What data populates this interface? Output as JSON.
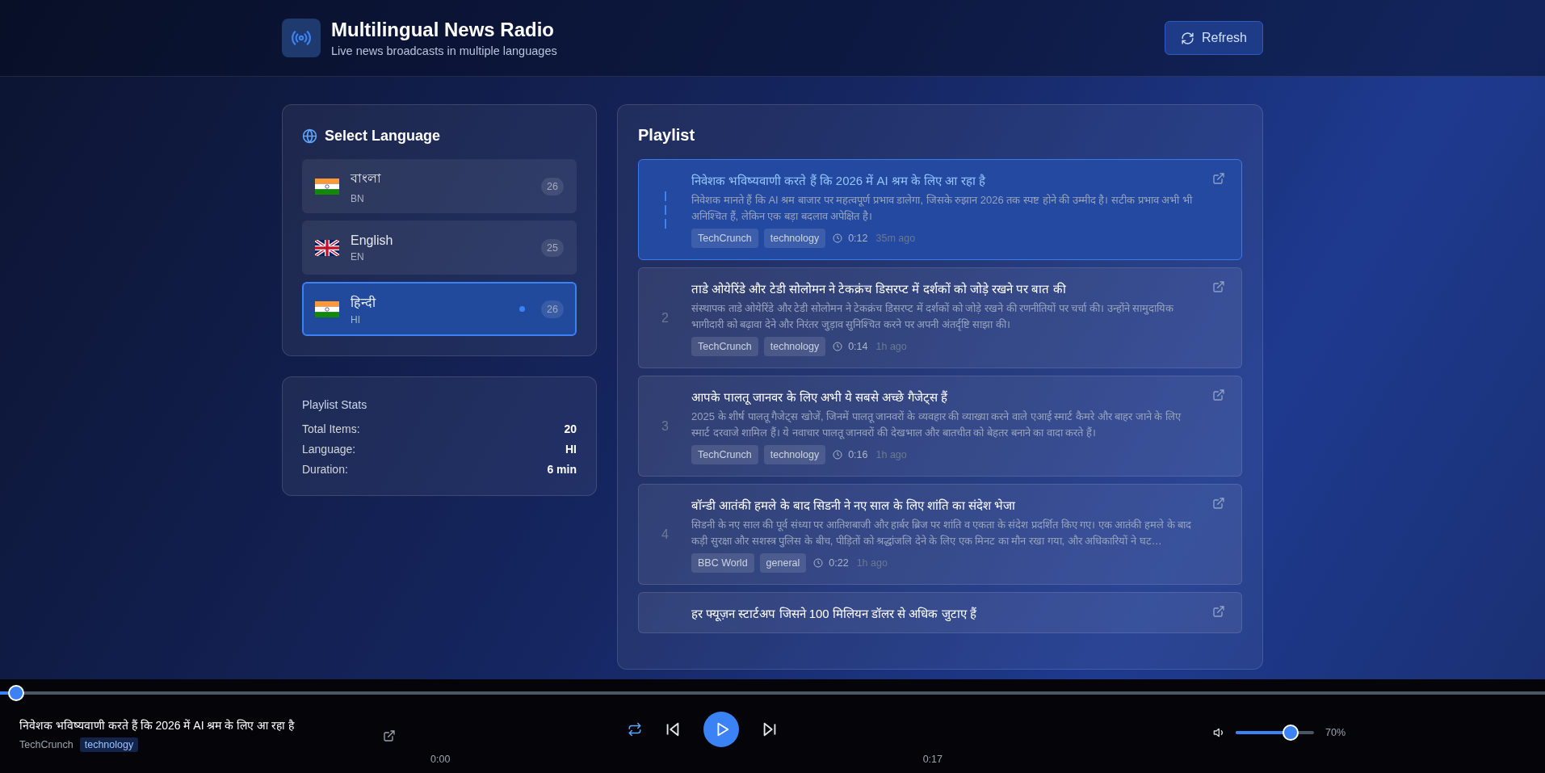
{
  "header": {
    "title": "Multilingual News Radio",
    "subtitle": "Live news broadcasts in multiple languages",
    "refresh_button": "Refresh"
  },
  "language_panel": {
    "title": "Select Language",
    "languages": [
      {
        "name": "বাংলা",
        "code": "BN",
        "count": "26",
        "kind": "india",
        "selected": false
      },
      {
        "name": "English",
        "code": "EN",
        "count": "25",
        "kind": "uk",
        "selected": false
      },
      {
        "name": "हिन्दी",
        "code": "HI",
        "count": "26",
        "kind": "india",
        "selected": true
      }
    ]
  },
  "stats": {
    "title": "Playlist Stats",
    "rows": [
      {
        "label": "Total Items:",
        "value": "20"
      },
      {
        "label": "Language:",
        "value": "HI"
      },
      {
        "label": "Duration:",
        "value": "6 min"
      }
    ]
  },
  "playlist": {
    "title": "Playlist",
    "items": [
      {
        "title": "निवेशक भविष्यवाणी करते हैं कि 2026 में AI श्रम के लिए आ रहा है",
        "description": "निवेशक मानते हैं कि AI श्रम बाजार पर महत्वपूर्ण प्रभाव डालेगा, जिसके रुझान 2026 तक स्पष्ट होने की उम्मीद है। सटीक प्रभाव अभी भी अनिश्चित हैं, लेकिन एक बड़ा बदलाव अपेक्षित है।",
        "source": "TechCrunch",
        "category": "technology",
        "duration": "0:12",
        "age": "35m ago",
        "selected": true
      },
      {
        "number": "2",
        "title": "ताडे ओयेरिंडे और टेडी सोलोमन ने टेकक्रंच डिसरप्ट में दर्शकों को जोड़े रखने पर बात की",
        "description": "संस्थापक ताडे ओयेरिंडे और टेडी सोलोमन ने टेकक्रंच डिसरप्ट में दर्शकों को जोड़े रखने की रणनीतियों पर चर्चा की। उन्होंने सामुदायिक भागीदारी को बढ़ावा देने और निरंतर जुड़ाव सुनिश्चित करने पर अपनी अंतर्दृष्टि साझा की।",
        "source": "TechCrunch",
        "category": "technology",
        "duration": "0:14",
        "age": "1h ago",
        "selected": false
      },
      {
        "number": "3",
        "title": "आपके पालतू जानवर के लिए अभी ये सबसे अच्छे गैजेट्स हैं",
        "description": "2025 के शीर्ष पालतू गैजेट्स खोजें, जिनमें पालतू जानवरों के व्यवहार की व्याख्या करने वाले एआई स्मार्ट कैमरे और बाहर जाने के लिए स्मार्ट दरवाजे शामिल हैं। ये नवाचार पालतू जानवरों की देखभाल और बातचीत को बेहतर बनाने का वादा करते हैं।",
        "source": "TechCrunch",
        "category": "technology",
        "duration": "0:16",
        "age": "1h ago",
        "selected": false
      },
      {
        "number": "4",
        "title": "बॉन्डी आतंकी हमले के बाद सिडनी ने नए साल के लिए शांति का संदेश भेजा",
        "description": "सिडनी के नए साल की पूर्व संध्या पर आतिशबाजी और हार्बर ब्रिज पर शांति व एकता के संदेश प्रदर्शित किए गए। एक आतंकी हमले के बाद कड़ी सुरक्षा और सशस्त्र पुलिस के बीच, पीड़ितों को श्रद्धांजलि देने के लिए एक मिनट का मौन रखा गया, और अधिकारियों ने घट…",
        "source": "BBC World",
        "category": "general",
        "duration": "0:22",
        "age": "1h ago",
        "selected": false
      },
      {
        "title": "हर फ्यूज़न स्टार्टअप जिसने 100 मिलियन डॉलर से अधिक जुटाए हैं",
        "selected": false
      }
    ]
  },
  "player": {
    "progress": {
      "level": 0.005
    },
    "title": "निवेशक भविष्यवाणी करते हैं कि 2026 में AI श्रम के लिए आ रहा है",
    "source": "TechCrunch",
    "category": "technology",
    "current_time": "0:00",
    "total_time": "0:17",
    "repeat": {
      "on": true
    },
    "volume": {
      "level": 0.7
    },
    "volume_reading": "70%"
  }
}
